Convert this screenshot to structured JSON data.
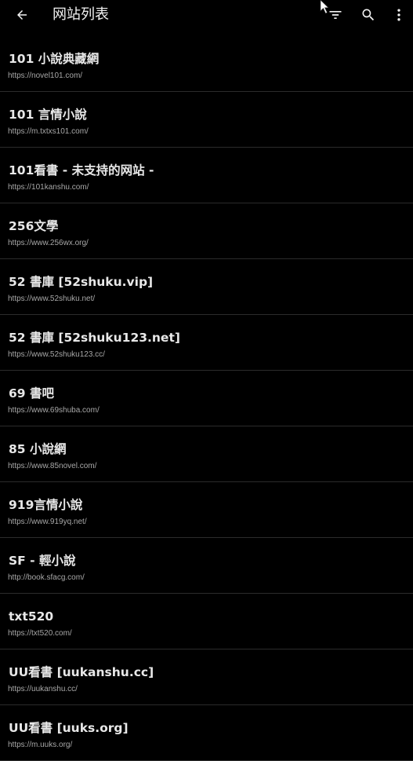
{
  "appbar": {
    "title": "网站列表",
    "icons": {
      "back": "arrow-left-icon",
      "filter": "filter-list-icon",
      "search": "search-icon",
      "more": "more-vertical-icon"
    }
  },
  "sites": [
    {
      "name": "101 小說典藏網",
      "url": "https://novel101.com/"
    },
    {
      "name": "101 言情小說",
      "url": "https://m.txtxs101.com/"
    },
    {
      "name": "101看書 - 未支持的网站 -",
      "url": "https://101kanshu.com/"
    },
    {
      "name": "256文學",
      "url": "https://www.256wx.org/"
    },
    {
      "name": "52 書庫 [52shuku.vip]",
      "url": "https://www.52shuku.net/"
    },
    {
      "name": "52 書庫 [52shuku123.net]",
      "url": "https://www.52shuku123.cc/"
    },
    {
      "name": "69 書吧",
      "url": "https://www.69shuba.com/"
    },
    {
      "name": "85 小說網",
      "url": "https://www.85novel.com/"
    },
    {
      "name": "919言情小說",
      "url": "https://www.919yq.net/"
    },
    {
      "name": "SF - 輕小說",
      "url": "http://book.sfacg.com/"
    },
    {
      "name": "txt520",
      "url": "https://txt520.com/"
    },
    {
      "name": "UU看書 [uukanshu.cc]",
      "url": "https://uukanshu.cc/"
    },
    {
      "name": "UU看書 [uuks.org]",
      "url": "https://m.uuks.org/"
    }
  ],
  "colors": {
    "background": "#000000",
    "title_text": "#e8e8e8",
    "url_text": "#a8a8a8",
    "divider": "#2b2b2b"
  }
}
